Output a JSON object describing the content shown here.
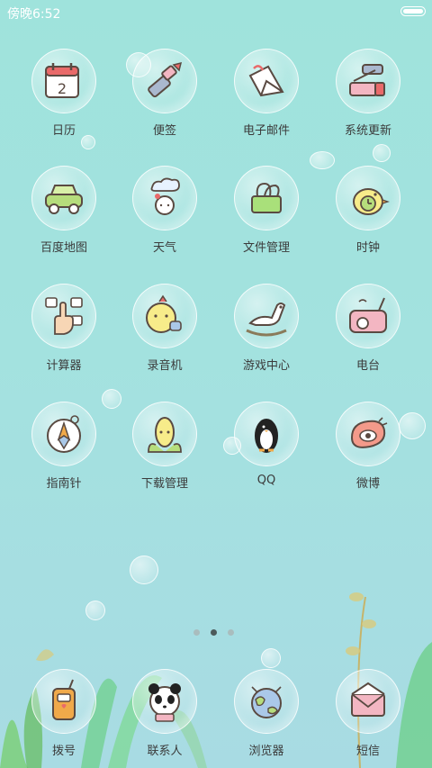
{
  "status_bar": {
    "time": "傍晚6:52"
  },
  "apps": [
    {
      "label": "日历",
      "icon": "calendar-icon"
    },
    {
      "label": "便签",
      "icon": "lipstick-note-icon"
    },
    {
      "label": "电子邮件",
      "icon": "mail-icon"
    },
    {
      "label": "系统更新",
      "icon": "toothpaste-update-icon"
    },
    {
      "label": "百度地图",
      "icon": "car-map-icon"
    },
    {
      "label": "天气",
      "icon": "cloud-girl-weather-icon"
    },
    {
      "label": "文件管理",
      "icon": "binder-clip-icon"
    },
    {
      "label": "时钟",
      "icon": "bird-clock-icon"
    },
    {
      "label": "计算器",
      "icon": "calculator-hand-icon"
    },
    {
      "label": "录音机",
      "icon": "chick-recorder-icon"
    },
    {
      "label": "游戏中心",
      "icon": "rocking-horse-icon"
    },
    {
      "label": "电台",
      "icon": "radio-icon"
    },
    {
      "label": "指南针",
      "icon": "compass-icon"
    },
    {
      "label": "下载管理",
      "icon": "corn-download-icon"
    },
    {
      "label": "QQ",
      "icon": "penguin-icon"
    },
    {
      "label": "微博",
      "icon": "weibo-eye-icon"
    }
  ],
  "pager": {
    "pages": 3,
    "active": 2
  },
  "dock": [
    {
      "label": "拨号",
      "icon": "phone-dial-icon"
    },
    {
      "label": "联系人",
      "icon": "panda-contacts-icon"
    },
    {
      "label": "浏览器",
      "icon": "globe-browser-icon"
    },
    {
      "label": "短信",
      "icon": "envelope-sms-icon"
    }
  ]
}
